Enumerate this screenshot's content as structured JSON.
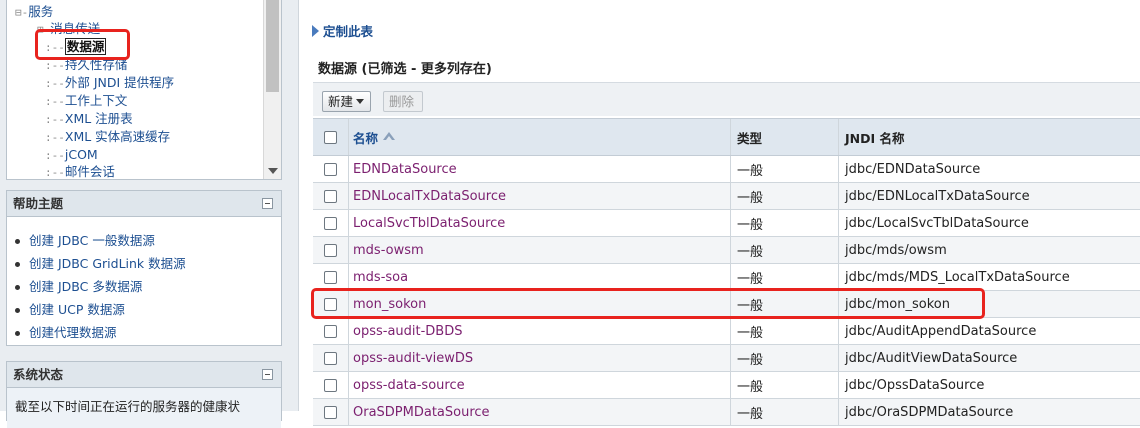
{
  "tree": {
    "root_label": "服务",
    "items": [
      {
        "label": "消息传送",
        "expand": "+"
      },
      {
        "label": "数据源"
      },
      {
        "label": "持久性存储"
      },
      {
        "label": "外部 JNDI 提供程序"
      },
      {
        "label": "工作上下文"
      },
      {
        "label": "XML 注册表"
      },
      {
        "label": "XML 实体高速缓存"
      },
      {
        "label": "jCOM"
      },
      {
        "label": "邮件会话"
      }
    ]
  },
  "help": {
    "title": "帮助主题",
    "items": [
      "创建 JDBC 一般数据源",
      "创建 JDBC GridLink 数据源",
      "创建 JDBC 多数据源",
      "创建 UCP 数据源",
      "创建代理数据源"
    ]
  },
  "status": {
    "title": "系统状态",
    "text": "截至以下时间正在运行的服务器的健康状"
  },
  "main": {
    "customize_label": "定制此表",
    "section_title": "数据源 (已筛选 - 更多列存在)",
    "new_button": "新建",
    "delete_button": "删除",
    "columns": {
      "name": "名称",
      "type": "类型",
      "jndi": "JNDI 名称"
    },
    "rows": [
      {
        "name": "EDNDataSource",
        "type": "一般",
        "jndi": "jdbc/EDNDataSource"
      },
      {
        "name": "EDNLocalTxDataSource",
        "type": "一般",
        "jndi": "jdbc/EDNLocalTxDataSource"
      },
      {
        "name": "LocalSvcTblDataSource",
        "type": "一般",
        "jndi": "jdbc/LocalSvcTblDataSource"
      },
      {
        "name": "mds-owsm",
        "type": "一般",
        "jndi": "jdbc/mds/owsm"
      },
      {
        "name": "mds-soa",
        "type": "一般",
        "jndi": "jdbc/mds/MDS_LocalTxDataSource"
      },
      {
        "name": "mon_sokon",
        "type": "一般",
        "jndi": "jdbc/mon_sokon"
      },
      {
        "name": "opss-audit-DBDS",
        "type": "一般",
        "jndi": "jdbc/AuditAppendDataSource"
      },
      {
        "name": "opss-audit-viewDS",
        "type": "一般",
        "jndi": "jdbc/AuditViewDataSource"
      },
      {
        "name": "opss-data-source",
        "type": "一般",
        "jndi": "jdbc/OpssDataSource"
      },
      {
        "name": "OraSDPMDataSource",
        "type": "一般",
        "jndi": "jdbc/OraSDPMDataSource"
      }
    ]
  },
  "colors": {
    "highlight": "#e8231e",
    "link": "#1d4f91",
    "visited_link": "#7b1f6f"
  }
}
